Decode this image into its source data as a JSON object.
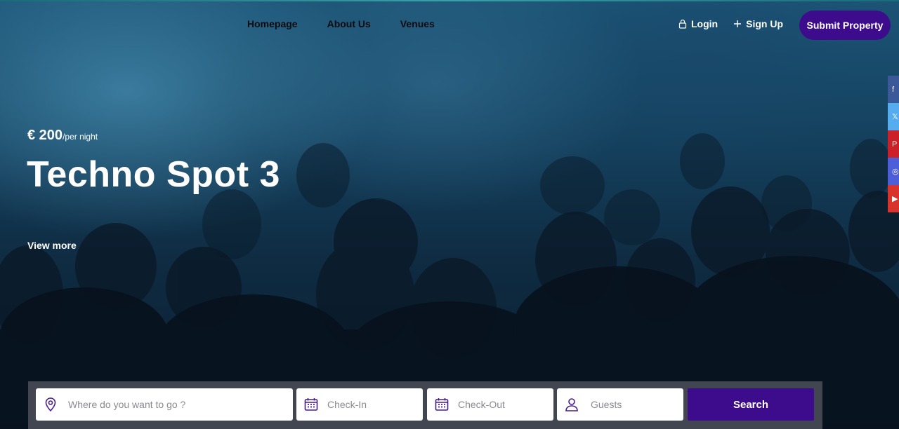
{
  "nav": {
    "items": [
      {
        "label": "Homepage"
      },
      {
        "label": "About Us"
      },
      {
        "label": "Venues"
      }
    ]
  },
  "auth": {
    "login_label": "Login",
    "signup_label": "Sign Up",
    "submit_label": "Submit Property"
  },
  "social": {
    "items": [
      {
        "icon": "facebook-icon",
        "color": "#3b5998"
      },
      {
        "icon": "twitter-icon",
        "color": "#55acee"
      },
      {
        "icon": "pinterest-icon",
        "color": "#cb2027"
      },
      {
        "icon": "instagram-icon",
        "color": "#4d5fd8"
      },
      {
        "icon": "youtube-icon",
        "color": "#d9342b"
      }
    ]
  },
  "hero": {
    "price": "€ 200",
    "price_unit": "/per night",
    "title": "Techno Spot 3",
    "view_more": "View more"
  },
  "search": {
    "location_placeholder": "Where do you want to go ?",
    "checkin_placeholder": "Check-In",
    "checkout_placeholder": "Check-Out",
    "guests_placeholder": "Guests",
    "button_label": "Search"
  },
  "colors": {
    "accent": "#3c0c8c",
    "icon": "#4a1a8c"
  }
}
